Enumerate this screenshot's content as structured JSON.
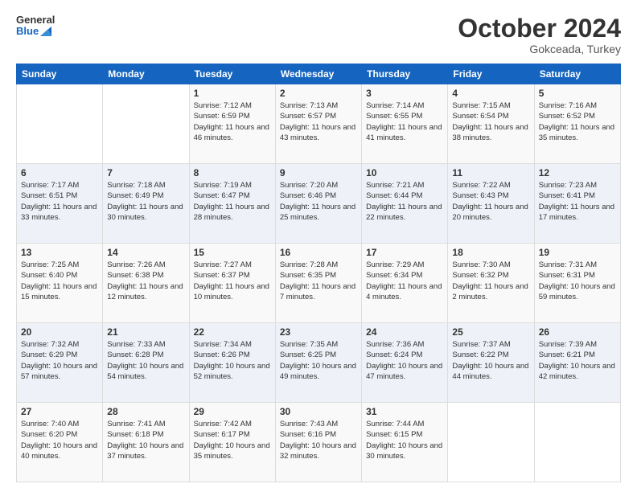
{
  "header": {
    "logo_line1": "General",
    "logo_line2": "Blue",
    "month": "October 2024",
    "location": "Gokceada, Turkey"
  },
  "weekdays": [
    "Sunday",
    "Monday",
    "Tuesday",
    "Wednesday",
    "Thursday",
    "Friday",
    "Saturday"
  ],
  "weeks": [
    [
      {
        "day": "",
        "info": ""
      },
      {
        "day": "",
        "info": ""
      },
      {
        "day": "1",
        "info": "Sunrise: 7:12 AM\nSunset: 6:59 PM\nDaylight: 11 hours and 46 minutes."
      },
      {
        "day": "2",
        "info": "Sunrise: 7:13 AM\nSunset: 6:57 PM\nDaylight: 11 hours and 43 minutes."
      },
      {
        "day": "3",
        "info": "Sunrise: 7:14 AM\nSunset: 6:55 PM\nDaylight: 11 hours and 41 minutes."
      },
      {
        "day": "4",
        "info": "Sunrise: 7:15 AM\nSunset: 6:54 PM\nDaylight: 11 hours and 38 minutes."
      },
      {
        "day": "5",
        "info": "Sunrise: 7:16 AM\nSunset: 6:52 PM\nDaylight: 11 hours and 35 minutes."
      }
    ],
    [
      {
        "day": "6",
        "info": "Sunrise: 7:17 AM\nSunset: 6:51 PM\nDaylight: 11 hours and 33 minutes."
      },
      {
        "day": "7",
        "info": "Sunrise: 7:18 AM\nSunset: 6:49 PM\nDaylight: 11 hours and 30 minutes."
      },
      {
        "day": "8",
        "info": "Sunrise: 7:19 AM\nSunset: 6:47 PM\nDaylight: 11 hours and 28 minutes."
      },
      {
        "day": "9",
        "info": "Sunrise: 7:20 AM\nSunset: 6:46 PM\nDaylight: 11 hours and 25 minutes."
      },
      {
        "day": "10",
        "info": "Sunrise: 7:21 AM\nSunset: 6:44 PM\nDaylight: 11 hours and 22 minutes."
      },
      {
        "day": "11",
        "info": "Sunrise: 7:22 AM\nSunset: 6:43 PM\nDaylight: 11 hours and 20 minutes."
      },
      {
        "day": "12",
        "info": "Sunrise: 7:23 AM\nSunset: 6:41 PM\nDaylight: 11 hours and 17 minutes."
      }
    ],
    [
      {
        "day": "13",
        "info": "Sunrise: 7:25 AM\nSunset: 6:40 PM\nDaylight: 11 hours and 15 minutes."
      },
      {
        "day": "14",
        "info": "Sunrise: 7:26 AM\nSunset: 6:38 PM\nDaylight: 11 hours and 12 minutes."
      },
      {
        "day": "15",
        "info": "Sunrise: 7:27 AM\nSunset: 6:37 PM\nDaylight: 11 hours and 10 minutes."
      },
      {
        "day": "16",
        "info": "Sunrise: 7:28 AM\nSunset: 6:35 PM\nDaylight: 11 hours and 7 minutes."
      },
      {
        "day": "17",
        "info": "Sunrise: 7:29 AM\nSunset: 6:34 PM\nDaylight: 11 hours and 4 minutes."
      },
      {
        "day": "18",
        "info": "Sunrise: 7:30 AM\nSunset: 6:32 PM\nDaylight: 11 hours and 2 minutes."
      },
      {
        "day": "19",
        "info": "Sunrise: 7:31 AM\nSunset: 6:31 PM\nDaylight: 10 hours and 59 minutes."
      }
    ],
    [
      {
        "day": "20",
        "info": "Sunrise: 7:32 AM\nSunset: 6:29 PM\nDaylight: 10 hours and 57 minutes."
      },
      {
        "day": "21",
        "info": "Sunrise: 7:33 AM\nSunset: 6:28 PM\nDaylight: 10 hours and 54 minutes."
      },
      {
        "day": "22",
        "info": "Sunrise: 7:34 AM\nSunset: 6:26 PM\nDaylight: 10 hours and 52 minutes."
      },
      {
        "day": "23",
        "info": "Sunrise: 7:35 AM\nSunset: 6:25 PM\nDaylight: 10 hours and 49 minutes."
      },
      {
        "day": "24",
        "info": "Sunrise: 7:36 AM\nSunset: 6:24 PM\nDaylight: 10 hours and 47 minutes."
      },
      {
        "day": "25",
        "info": "Sunrise: 7:37 AM\nSunset: 6:22 PM\nDaylight: 10 hours and 44 minutes."
      },
      {
        "day": "26",
        "info": "Sunrise: 7:39 AM\nSunset: 6:21 PM\nDaylight: 10 hours and 42 minutes."
      }
    ],
    [
      {
        "day": "27",
        "info": "Sunrise: 7:40 AM\nSunset: 6:20 PM\nDaylight: 10 hours and 40 minutes."
      },
      {
        "day": "28",
        "info": "Sunrise: 7:41 AM\nSunset: 6:18 PM\nDaylight: 10 hours and 37 minutes."
      },
      {
        "day": "29",
        "info": "Sunrise: 7:42 AM\nSunset: 6:17 PM\nDaylight: 10 hours and 35 minutes."
      },
      {
        "day": "30",
        "info": "Sunrise: 7:43 AM\nSunset: 6:16 PM\nDaylight: 10 hours and 32 minutes."
      },
      {
        "day": "31",
        "info": "Sunrise: 7:44 AM\nSunset: 6:15 PM\nDaylight: 10 hours and 30 minutes."
      },
      {
        "day": "",
        "info": ""
      },
      {
        "day": "",
        "info": ""
      }
    ]
  ]
}
